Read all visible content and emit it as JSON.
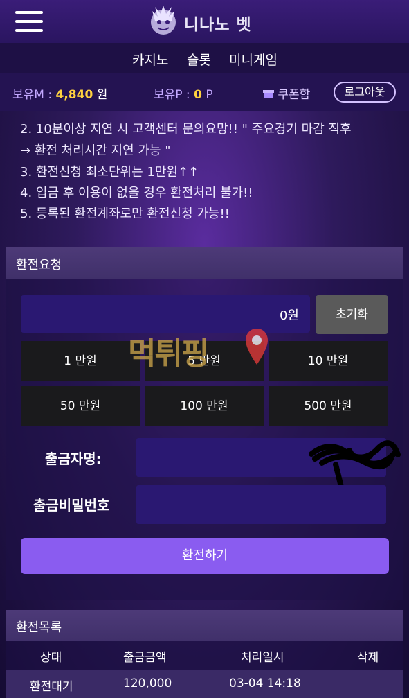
{
  "header": {
    "brand": "니나노 벳"
  },
  "nav": [
    "카지노",
    "슬롯",
    "미니게임"
  ],
  "account": {
    "money_label": "보유M :",
    "money_value": "4,840",
    "money_unit": "원",
    "point_label": "보유P :",
    "point_value": "0",
    "point_unit": "P",
    "coupon": "쿠폰함",
    "logout": "로그아웃"
  },
  "notices": [
    "2. 10분이상 지연 시 고객센터 문의요망!! \" 주요경기 마감 직후",
    "→ 환전 처리시간 지연 가능 \"",
    "3. 환전신청 최소단위는 1만원↑↑",
    "4. 입금 후 이용이 없을 경우 환전처리 불가!!",
    "5. 등록된 환전계좌로만 환전신청 가능!!"
  ],
  "withdraw": {
    "title": "환전요청",
    "amount": "0원",
    "reset": "초기화",
    "amount_buttons": [
      "1 만원",
      "5 만원",
      "10 만원",
      "50 만원",
      "100 만원",
      "500 만원"
    ],
    "name_label": "출금자명:",
    "password_label": "출금비밀번호",
    "submit": "환전하기"
  },
  "history": {
    "title": "환전목록",
    "columns": [
      "상태",
      "출금금액",
      "처리일시",
      "삭제"
    ],
    "rows": [
      {
        "status": "환전대기",
        "amount": "120,000",
        "date": "03-04 14:18"
      }
    ]
  },
  "watermark": {
    "text": "먹튀핑"
  },
  "colors": {
    "accent": "#8a5cf0",
    "highlight": "#ffd23f",
    "input_bg": "#2a1872",
    "background": "#2e1a5c"
  },
  "icons": {
    "menu": "hamburger-menu-icon",
    "coupon": "coupon-box-icon",
    "logo": "dragon-emblem-icon",
    "watermark_pin": "location-pin-icon"
  }
}
